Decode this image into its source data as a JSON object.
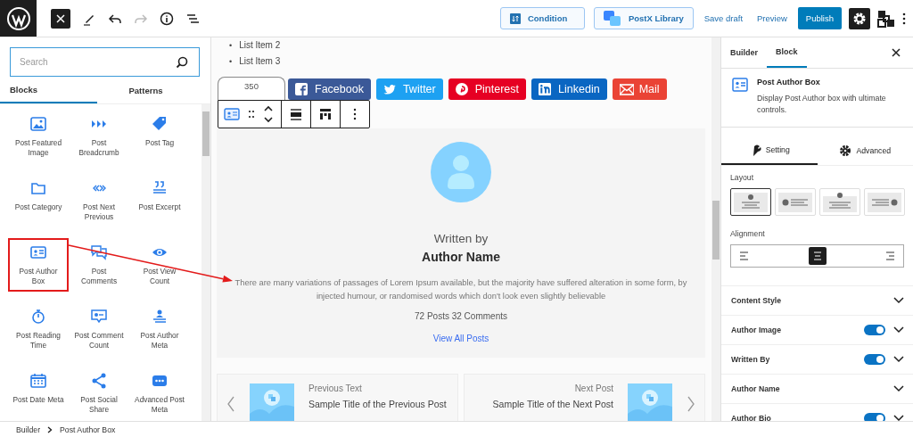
{
  "top_bar": {
    "settings_active": true,
    "buttons": [
      {
        "label": "Condition",
        "kind": "outline"
      },
      {
        "label": "PostX Library",
        "kind": "outline"
      },
      {
        "label": "Save draft",
        "kind": "link"
      },
      {
        "label": "Preview",
        "kind": "link"
      },
      {
        "label": "Publish",
        "kind": "primary"
      }
    ]
  },
  "inserter": {
    "search": {
      "placeholder": "Search"
    },
    "tabs": [
      {
        "label": "Blocks",
        "selected": true
      },
      {
        "label": "Patterns",
        "selected": false
      }
    ],
    "blocks": [
      {
        "label": "Post Featured Image",
        "marked": false
      },
      {
        "label": "Post Breadcrumb",
        "marked": false
      },
      {
        "label": "Post Tag",
        "marked": false
      },
      {
        "label": "Post Category",
        "marked": false
      },
      {
        "label": "Post Next Previous",
        "marked": false
      },
      {
        "label": "Post Excerpt",
        "marked": false
      },
      {
        "label": "Post Author Box",
        "marked": true
      },
      {
        "label": "Post Comments",
        "marked": false
      },
      {
        "label": "Post View Count",
        "marked": false
      },
      {
        "label": "Post Reading Time",
        "marked": false
      },
      {
        "label": "Post Comment Count",
        "marked": false
      },
      {
        "label": "Post Author Meta",
        "marked": false
      },
      {
        "label": "Post Date Meta",
        "marked": false
      },
      {
        "label": "Post Social Share",
        "marked": false
      },
      {
        "label": "Advanced Post Meta",
        "marked": false
      }
    ]
  },
  "canvas": {
    "list_items": [
      {
        "marker": "•",
        "text": "List Item 2"
      },
      {
        "marker": "•",
        "text": "List Item 3"
      }
    ],
    "width_tooltip": "350",
    "share_buttons": [
      {
        "label": "Facebook",
        "color": "#3b5998"
      },
      {
        "label": "Twitter",
        "color": "#1da1f2"
      },
      {
        "label": "Pinterest",
        "color": "#e60023"
      },
      {
        "label": "Linkedin",
        "color": "#0a66c2"
      },
      {
        "label": "Mail",
        "color": "#ea4335"
      }
    ],
    "author_box": {
      "written_by": "Written by",
      "name": "Author Name",
      "bio": "There are many variations of passages of Lorem Ipsum available, but the majority have suffered alteration in some form, by injected humour, or randomised words which don't look even slightly believable",
      "stats": "72 Posts 32 Comments",
      "link": "View All Posts"
    },
    "post_nav": [
      {
        "kind": "previous",
        "label": "Previous Text",
        "title": "Sample Title of the Previous Post"
      },
      {
        "kind": "next",
        "label": "Next Post",
        "title": "Sample Title of the Next Post"
      }
    ]
  },
  "settings_panel": {
    "tabs": [
      {
        "label": "Builder",
        "selected": false
      },
      {
        "label": "Block",
        "selected": true
      }
    ],
    "block": {
      "title": "Post Author Box",
      "description": "Display Post Author box with ultimate controls."
    },
    "subtabs": [
      {
        "label": "Setting",
        "selected": true
      },
      {
        "label": "Advanced",
        "selected": false
      }
    ],
    "layout": {
      "label": "Layout",
      "options": [
        {
          "selected": true
        },
        {
          "selected": false
        },
        {
          "selected": false
        },
        {
          "selected": false
        }
      ]
    },
    "alignment": {
      "label": "Alignment",
      "options": [
        {
          "selected": false
        },
        {
          "selected": true
        },
        {
          "selected": false
        }
      ]
    },
    "sections": [
      {
        "label": "Content Style"
      },
      {
        "label": "Author Image",
        "on": true
      },
      {
        "label": "Written By",
        "on": true
      },
      {
        "label": "Author Name"
      },
      {
        "label": "Author Bio",
        "on": true
      }
    ]
  },
  "status_bar": {
    "breadcrumb": [
      "Builder",
      "Post Author Box"
    ]
  }
}
